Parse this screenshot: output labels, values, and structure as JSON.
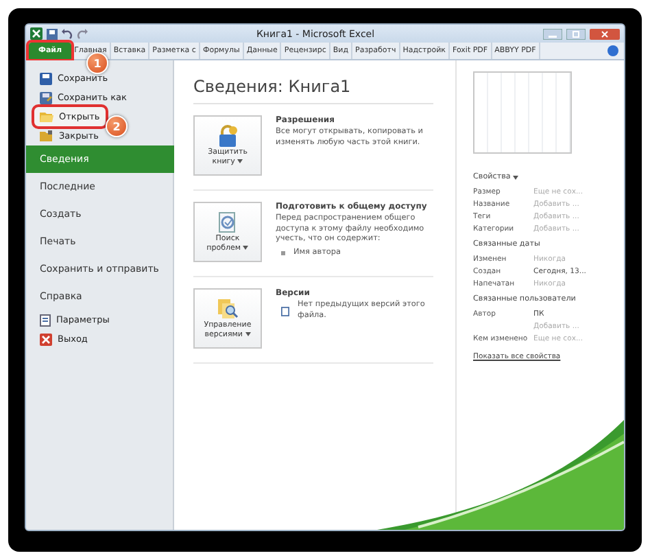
{
  "window": {
    "title": "Книга1 - Microsoft Excel"
  },
  "ribbon": {
    "tabs": [
      {
        "label": "Файл",
        "selected": true
      },
      {
        "label": "Главная",
        "selected": false
      },
      {
        "label": "Вставка",
        "selected": false
      },
      {
        "label": "Разметка с",
        "selected": false
      },
      {
        "label": "Формулы",
        "selected": false
      },
      {
        "label": "Данные",
        "selected": false
      },
      {
        "label": "Рецензирс",
        "selected": false
      },
      {
        "label": "Вид",
        "selected": false
      },
      {
        "label": "Разработч",
        "selected": false
      },
      {
        "label": "Надстройк",
        "selected": false
      },
      {
        "label": "Foxit PDF",
        "selected": false
      },
      {
        "label": "ABBYY PDF",
        "selected": false
      }
    ]
  },
  "callouts": [
    "1",
    "2"
  ],
  "sidebar": {
    "items": [
      {
        "kind": "command",
        "label": "Сохранить",
        "highlighted": false
      },
      {
        "kind": "command",
        "label": "Сохранить как",
        "highlighted": false
      },
      {
        "kind": "command",
        "label": "Открыть",
        "highlighted": true
      },
      {
        "kind": "command",
        "label": "Закрыть",
        "highlighted": false
      },
      {
        "kind": "section",
        "label": "Сведения",
        "selected": true
      },
      {
        "kind": "section",
        "label": "Последние",
        "selected": false
      },
      {
        "kind": "section",
        "label": "Создать",
        "selected": false
      },
      {
        "kind": "section",
        "label": "Печать",
        "selected": false
      },
      {
        "kind": "section",
        "label": "Сохранить и отправить",
        "selected": false
      },
      {
        "kind": "section",
        "label": "Справка",
        "selected": false
      },
      {
        "kind": "command",
        "label": "Параметры",
        "highlighted": false
      },
      {
        "kind": "command",
        "label": "Выход",
        "highlighted": false
      }
    ]
  },
  "info": {
    "title": "Сведения: Книга1",
    "sections": [
      {
        "button": [
          "Защитить",
          "книгу"
        ],
        "heading": "Разрешения",
        "text": "Все могут открывать, копировать и изменять любую часть этой книги."
      },
      {
        "button": [
          "Поиск",
          "проблем"
        ],
        "heading": "Подготовить к общему доступу",
        "text": "Перед распространением общего доступа к этому файлу необходимо учесть, что он содержит:",
        "bullets": [
          "Имя автора"
        ]
      },
      {
        "button": [
          "Управление",
          "версиями"
        ],
        "heading": "Версии",
        "note": "Нет предыдущих версий этого файла."
      }
    ]
  },
  "properties": {
    "groups": [
      {
        "title": "Свойства",
        "dropdown": true,
        "rows": [
          {
            "label": "Размер",
            "value": "Еще не сох...",
            "muted": true
          },
          {
            "label": "Название",
            "value": "Добавить ...",
            "muted": true
          },
          {
            "label": "Теги",
            "value": "Добавить ...",
            "muted": true
          },
          {
            "label": "Категории",
            "value": "Добавить ...",
            "muted": true
          }
        ]
      },
      {
        "title": "Связанные даты",
        "dropdown": false,
        "rows": [
          {
            "label": "Изменен",
            "value": "Никогда",
            "muted": true
          },
          {
            "label": "Создан",
            "value": "Сегодня, 13...",
            "muted": false
          },
          {
            "label": "Напечатан",
            "value": "Никогда",
            "muted": true
          }
        ]
      },
      {
        "title": "Связанные пользователи",
        "dropdown": false,
        "rows": [
          {
            "label": "Автор",
            "value": "ПК",
            "muted": false
          },
          {
            "value": "Добавить ...",
            "muted": true
          },
          {
            "label": "Кем изменено",
            "value": "Еще не сох...",
            "muted": true
          }
        ]
      }
    ],
    "link": "Показать все свойства"
  }
}
